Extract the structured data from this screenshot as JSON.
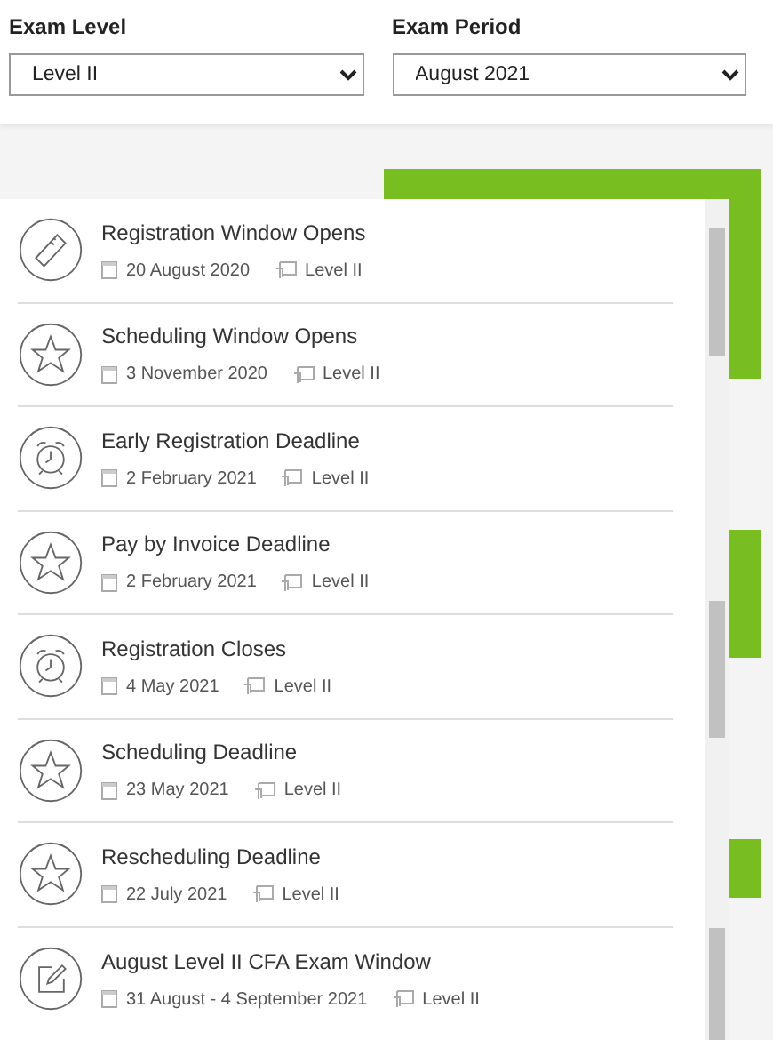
{
  "filters": [
    {
      "label": "Exam Level",
      "value": "Level II"
    },
    {
      "label": "Exam Period",
      "value": "August 2021"
    }
  ],
  "events": [
    {
      "kind": "ticket",
      "title": "Registration Window Opens",
      "date": "20 August 2020",
      "level": "Level II"
    },
    {
      "kind": "star",
      "title": "Scheduling Window Opens",
      "date": "3 November 2020",
      "level": "Level II"
    },
    {
      "kind": "alarm",
      "title": "Early Registration Deadline",
      "date": "2 February 2021",
      "level": "Level II"
    },
    {
      "kind": "star",
      "title": "Pay by Invoice Deadline",
      "date": "2 February 2021",
      "level": "Level II"
    },
    {
      "kind": "alarm",
      "title": "Registration Closes",
      "date": "4 May 2021",
      "level": "Level II"
    },
    {
      "kind": "star",
      "title": "Scheduling Deadline",
      "date": "23 May 2021",
      "level": "Level II"
    },
    {
      "kind": "star",
      "title": "Rescheduling Deadline",
      "date": "22 July 2021",
      "level": "Level II"
    },
    {
      "kind": "edit",
      "title": "August Level II CFA Exam Window",
      "date": "31 August - 4 September 2021",
      "level": "Level II"
    }
  ]
}
